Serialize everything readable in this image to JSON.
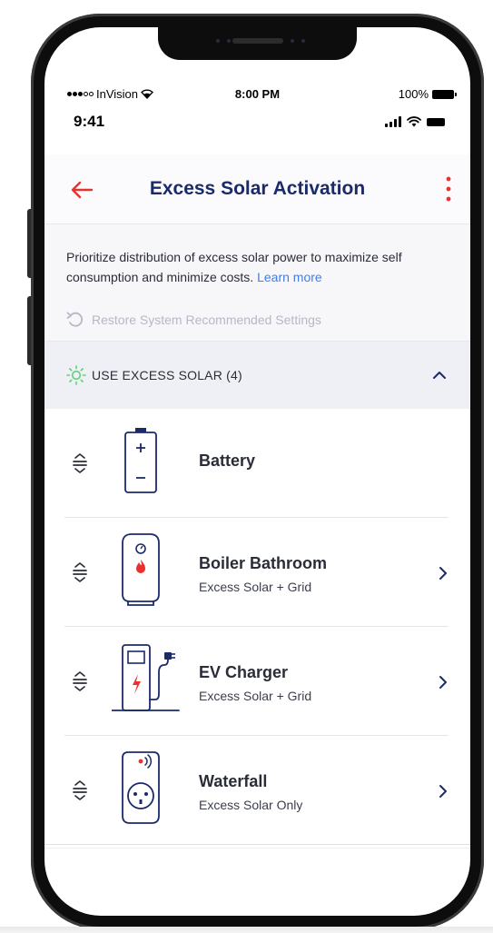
{
  "prototype_status": {
    "carrier": "InVision",
    "time": "8:00 PM",
    "battery": "100%"
  },
  "device_status": {
    "time": "9:41"
  },
  "header": {
    "title": "Excess Solar Activation",
    "back_icon": "arrow-left-icon",
    "more_icon": "more-vertical-icon"
  },
  "intro": {
    "description": "Prioritize distribution of excess solar power to maximize self consumption and minimize costs.",
    "learn_more": "Learn more",
    "restore_label": "Restore System Recommended Settings"
  },
  "section": {
    "label": "USE EXCESS SOLAR (4)",
    "icon": "sun-icon"
  },
  "devices": [
    {
      "name": "Battery",
      "mode": "",
      "icon": "battery-device-icon"
    },
    {
      "name": "Boiler Bathroom",
      "mode": "Excess Solar + Grid",
      "icon": "boiler-device-icon"
    },
    {
      "name": "EV Charger",
      "mode": "Excess Solar + Grid",
      "icon": "ev-charger-device-icon"
    },
    {
      "name": "Waterfall",
      "mode": "Excess Solar Only",
      "icon": "smart-plug-device-icon"
    }
  ],
  "colors": {
    "primary_text": "#1b2a6b",
    "accent_red": "#e8322f",
    "link_blue": "#3f7ee8",
    "sun_green": "#5fd07a",
    "muted": "#b5b8c5"
  }
}
